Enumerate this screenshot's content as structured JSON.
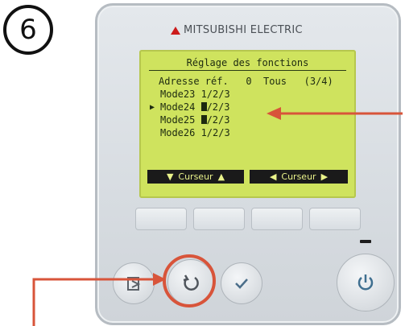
{
  "step": {
    "number": "6"
  },
  "brand": {
    "name": "MITSUBISHI ELECTRIC",
    "logo_color": "#cc1b1b"
  },
  "lcd": {
    "title": "Réglage des fonctions",
    "rows": [
      {
        "text": "Adresse réf.   0  Tous   (3/4)"
      },
      {
        "text": "Mode23 1/2/3"
      },
      {
        "prefix": "Mode24 ",
        "suffix": "/2/3",
        "marker": "▶"
      },
      {
        "prefix": "Mode25 ",
        "suffix": "/2/3"
      },
      {
        "text": "Mode26 1/2/3"
      }
    ],
    "softkeys": [
      {
        "label": "Curseur",
        "left_glyph": "▼",
        "right_glyph": "▲"
      },
      {
        "label": "Curseur",
        "left_glyph": "◀",
        "right_glyph": "▶"
      }
    ],
    "background_color": "#cfe35e"
  },
  "buttons": {
    "menu_icon": "menu-icon",
    "return_icon": "return-icon",
    "ok_icon": "check-icon",
    "power_icon": "power-icon"
  },
  "colors": {
    "annotation_red": "#d8543a",
    "device_body": "#dbe0e5"
  }
}
